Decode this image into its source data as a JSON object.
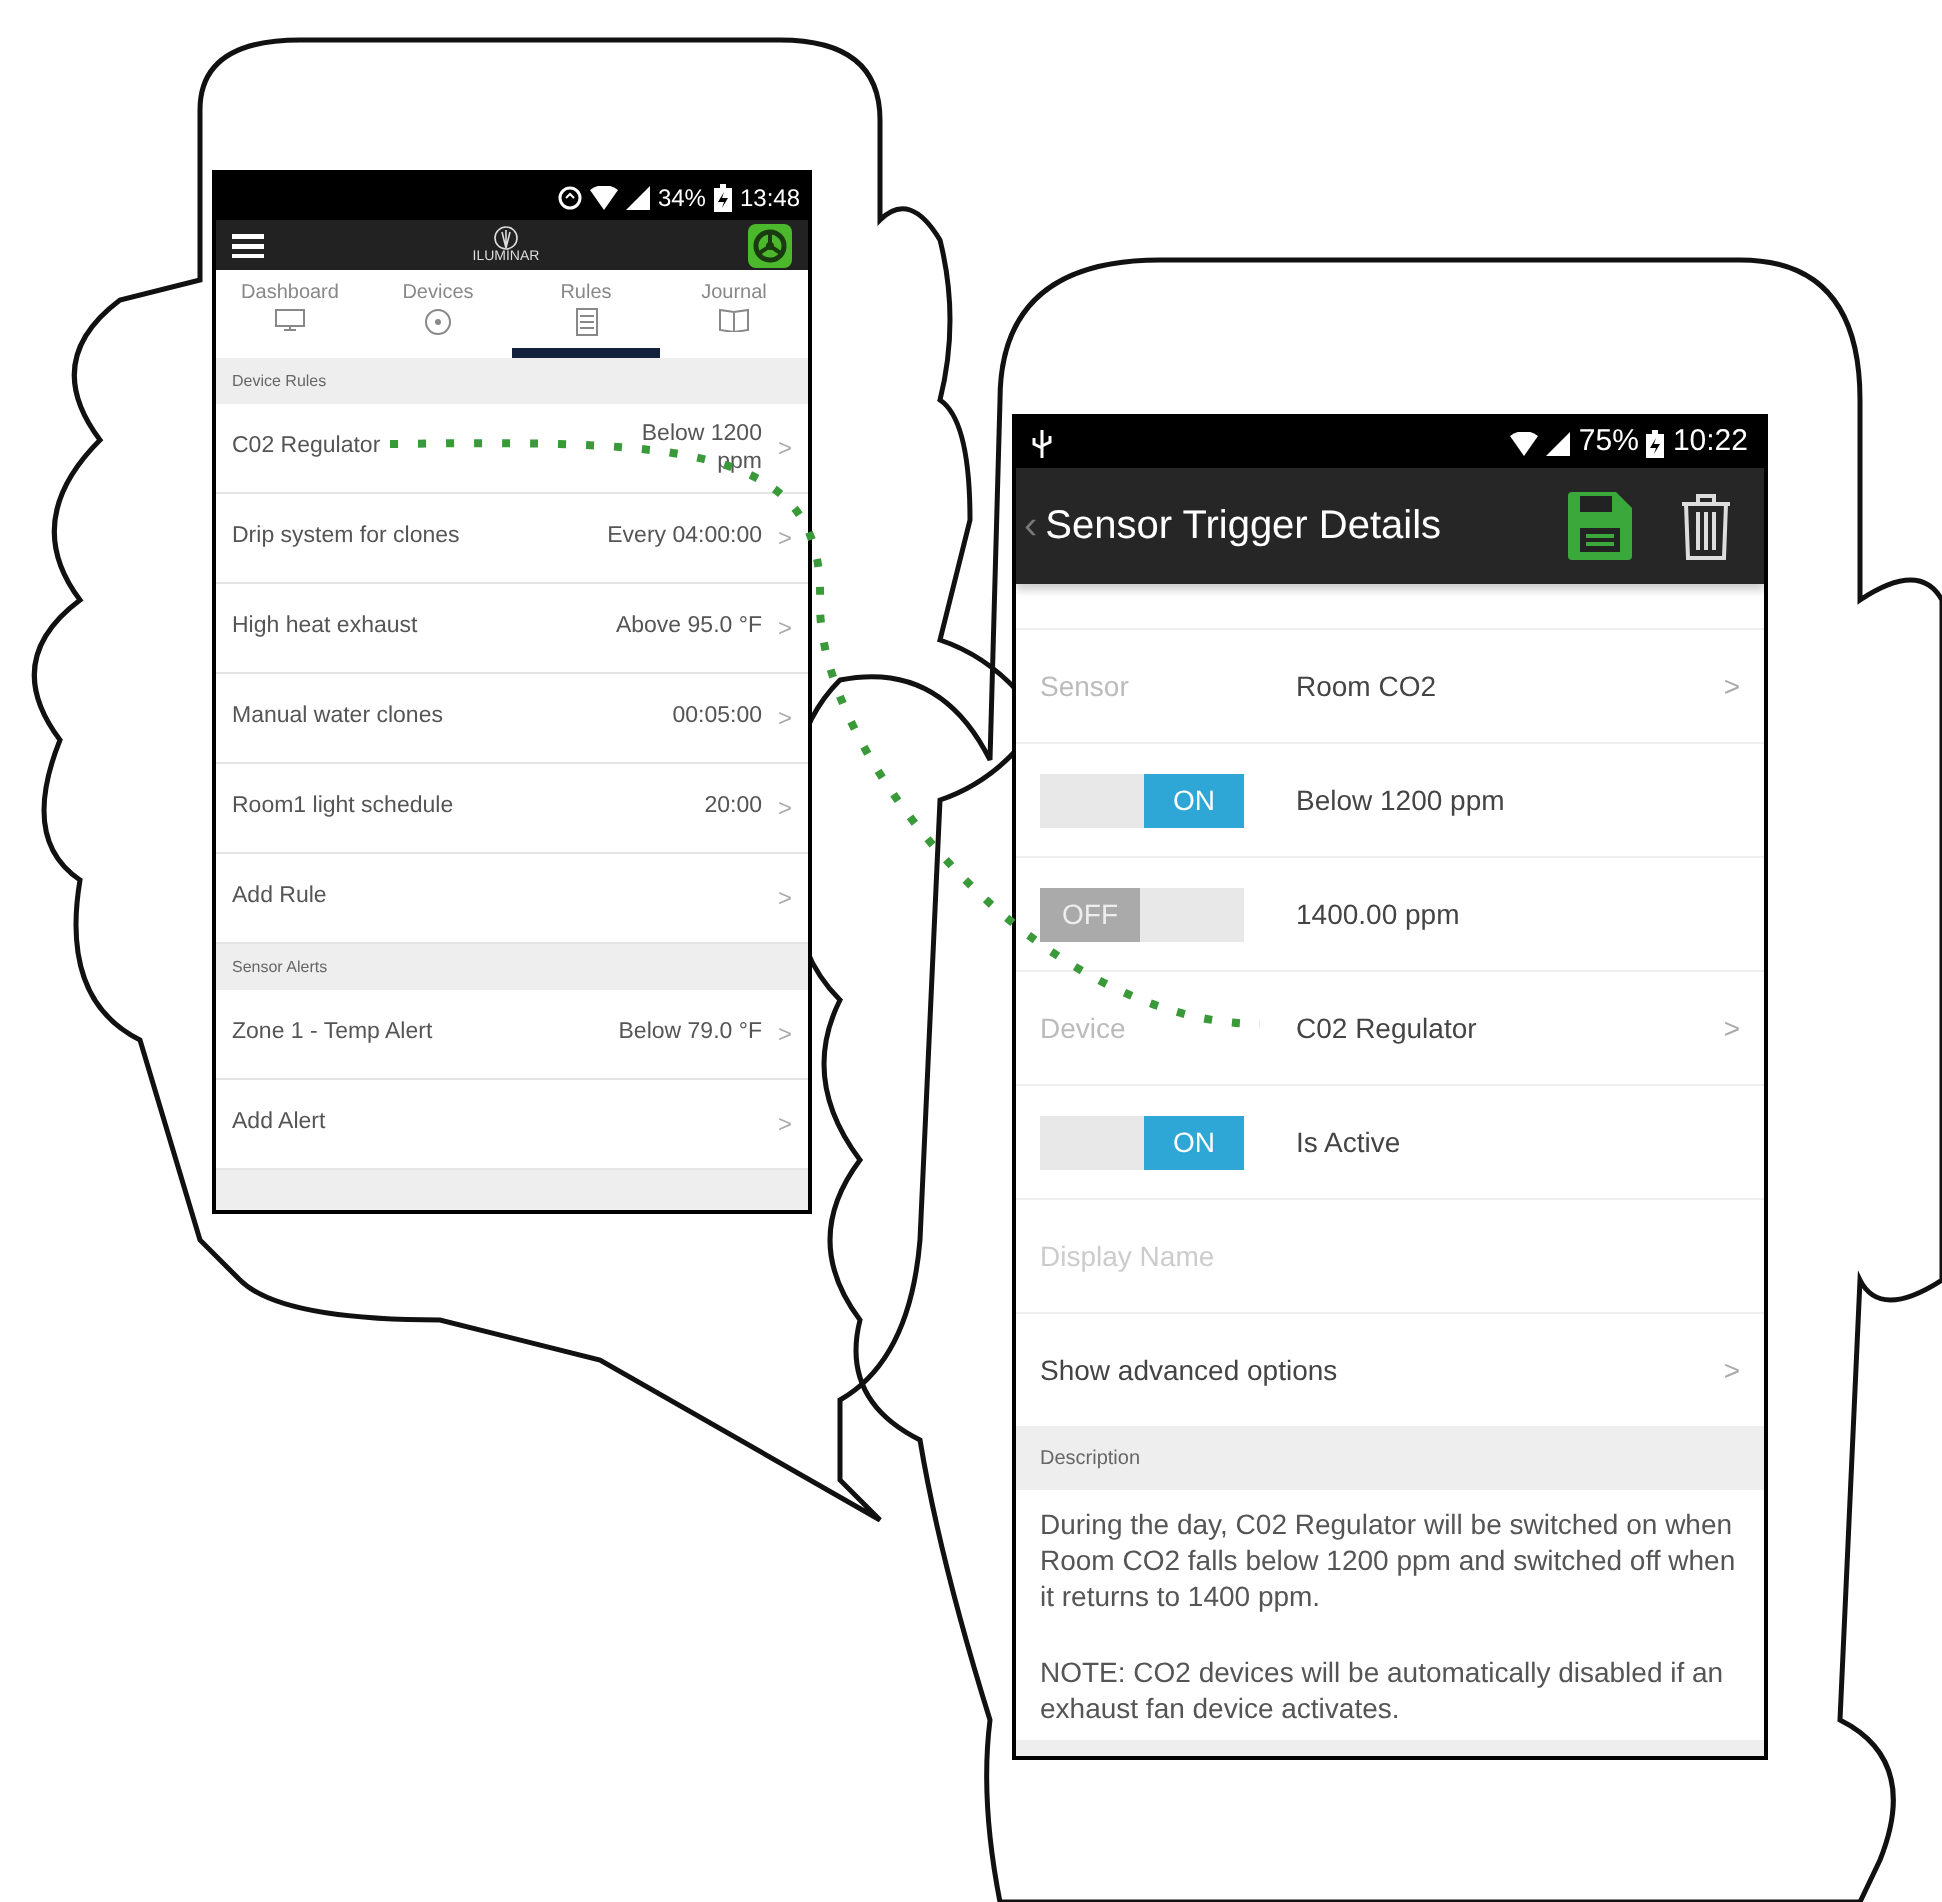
{
  "left_phone": {
    "status_bar": {
      "battery": "34%",
      "time": "13:48"
    },
    "app_bar": {
      "logo": "ILUMINAR"
    },
    "tabs": [
      {
        "label": "Dashboard",
        "selected": false
      },
      {
        "label": "Devices",
        "selected": false
      },
      {
        "label": "Rules",
        "selected": true
      },
      {
        "label": "Journal",
        "selected": false
      }
    ],
    "sections": [
      {
        "title": "Device Rules",
        "rows": [
          {
            "label": "C02 Regulator",
            "value": "Below 1200 ppm",
            "arrow": ">"
          },
          {
            "label": "Drip system for clones",
            "value": "Every 04:00:00",
            "arrow": ">"
          },
          {
            "label": "High heat exhaust",
            "value": "Above 95.0 °F",
            "arrow": ">"
          },
          {
            "label": "Manual water clones",
            "value": "00:05:00",
            "arrow": ">"
          },
          {
            "label": "Room1 light schedule",
            "value": "20:00",
            "arrow": ">"
          },
          {
            "label": "Add Rule",
            "arrow": ">"
          }
        ]
      },
      {
        "title": "Sensor Alerts",
        "rows": [
          {
            "label": "Zone 1 - Temp Alert",
            "value": "Below 79.0 °F",
            "arrow": ">"
          },
          {
            "label": "Add Alert",
            "arrow": ">"
          }
        ]
      }
    ]
  },
  "right_phone": {
    "status_bar": {
      "battery": "75%",
      "time": "10:22"
    },
    "app_bar": {
      "back": "‹",
      "title": "Sensor Trigger Details"
    },
    "rows": [
      {
        "kind": "field",
        "label": "Sensor",
        "value": "Room CO2",
        "arrow": ">"
      },
      {
        "kind": "toggle",
        "toggle": "ON",
        "on": true,
        "value": "Below 1200 ppm"
      },
      {
        "kind": "toggle",
        "toggle": "OFF",
        "on": false,
        "value": "1400.00 ppm"
      },
      {
        "kind": "field",
        "label": "Device",
        "value": "C02 Regulator",
        "arrow": ">"
      },
      {
        "kind": "toggle",
        "toggle": "ON",
        "on": true,
        "value": "Is Active"
      },
      {
        "kind": "input",
        "placeholder": "Display Name"
      },
      {
        "kind": "link",
        "label": "Show advanced options",
        "arrow": ">"
      }
    ],
    "description": {
      "title": "Description",
      "paragraphs": [
        "During the day, C02 Regulator will be switched on when Room CO2 falls below 1200 ppm and switched off when it returns to 1400 ppm.",
        "NOTE: CO2 devices will be automatically disabled if an exhaust fan device activates."
      ]
    }
  }
}
